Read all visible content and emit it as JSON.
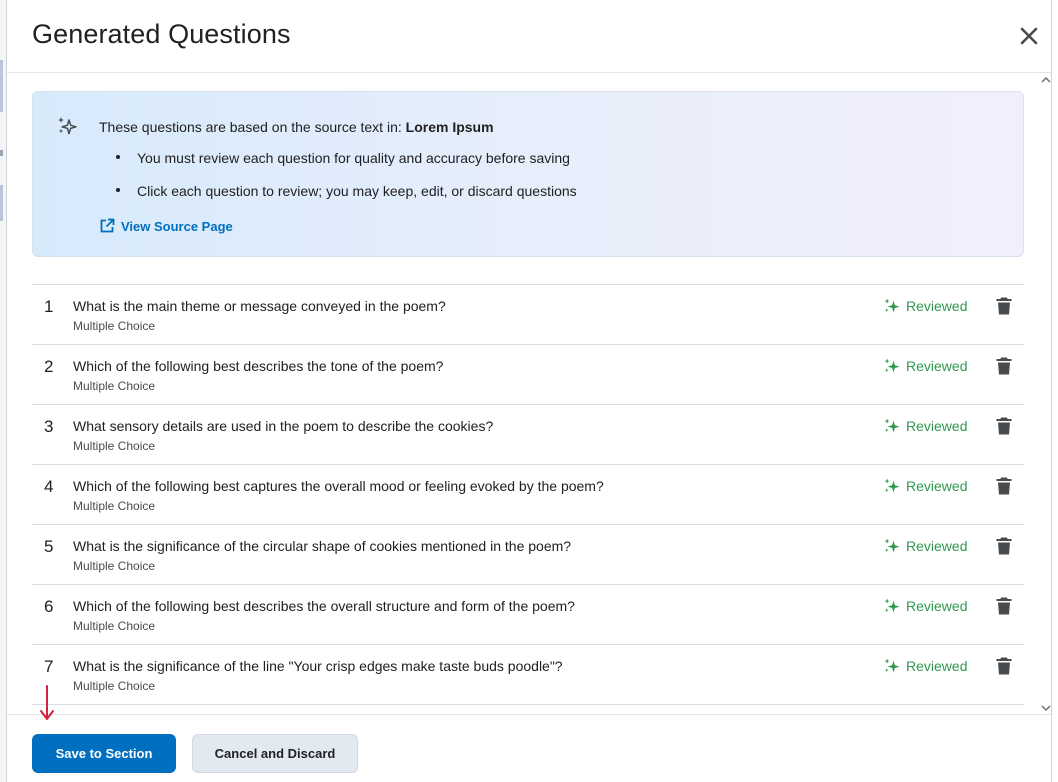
{
  "dialog": {
    "title": "Generated Questions",
    "close_icon": "close-icon"
  },
  "info": {
    "icon": "sparkle-icon",
    "lead_prefix": "These questions are based on the source text in: ",
    "source_name": "Lorem Ipsum",
    "bullets": [
      "You must review each question for quality and accuracy before saving",
      "Click each question to review; you may keep, edit, or discard questions"
    ],
    "view_source_label": "View Source Page",
    "view_source_icon": "external-link-icon"
  },
  "questions": [
    {
      "number": "1",
      "text": "What is the main theme or message conveyed in the poem?",
      "type": "Multiple Choice",
      "status": "Reviewed"
    },
    {
      "number": "2",
      "text": "Which of the following best describes the tone of the poem?",
      "type": "Multiple Choice",
      "status": "Reviewed"
    },
    {
      "number": "3",
      "text": "What sensory details are used in the poem to describe the cookies?",
      "type": "Multiple Choice",
      "status": "Reviewed"
    },
    {
      "number": "4",
      "text": "Which of the following best captures the overall mood or feeling evoked by the poem?",
      "type": "Multiple Choice",
      "status": "Reviewed"
    },
    {
      "number": "5",
      "text": "What is the significance of the circular shape of cookies mentioned in the poem?",
      "type": "Multiple Choice",
      "status": "Reviewed"
    },
    {
      "number": "6",
      "text": "Which of the following best describes the overall structure and form of the poem?",
      "type": "Multiple Choice",
      "status": "Reviewed"
    },
    {
      "number": "7",
      "text": "What is the significance of the line \"Your crisp edges make taste buds poodle\"?",
      "type": "Multiple Choice",
      "status": "Reviewed"
    }
  ],
  "footer": {
    "save_label": "Save to Section",
    "cancel_label": "Cancel and Discard"
  },
  "colors": {
    "primary": "#006fbf",
    "reviewed": "#2f9a4e",
    "annotation_arrow": "#d0243c"
  }
}
